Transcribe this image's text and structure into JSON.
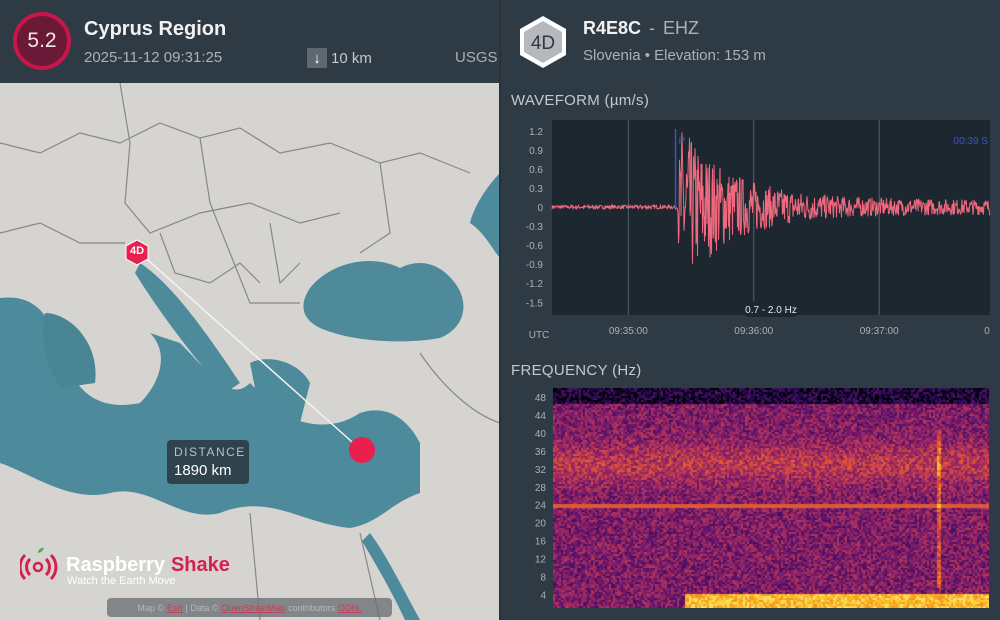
{
  "event": {
    "magnitude": "5.2",
    "region": "Cyprus Region",
    "datetime": "2025-11-12 09:31:25",
    "depth": "10 km",
    "depth_icon": "arrow-down-icon",
    "source": "USGS"
  },
  "map": {
    "distance_label": "DISTANCE",
    "distance_value": "1890 km",
    "station_marker": "4D",
    "brand_part1": "Raspberry",
    "brand_part2": "Shake",
    "brand_tagline": "Watch the Earth Move",
    "attribution": {
      "map_prefix": "Map ©",
      "map_link": "Esri",
      "data_prefix": "| Data ©",
      "data_link": "OpenStreetMap",
      "contributors": "contributors",
      "license_link": "ODbL"
    }
  },
  "station": {
    "network": "4D",
    "code": "R4E8C",
    "dash": "-",
    "channel": "EHZ",
    "location": "Slovenia • Elevation: 153 m"
  },
  "waveform": {
    "title": "WAVEFORM  (µm/s)",
    "filter_label": "0.7 - 2.0 Hz",
    "p_label": "P",
    "s_label": "00:39  S",
    "tz_label": "UTC"
  },
  "frequency": {
    "title": "FREQUENCY  (Hz)"
  },
  "colors": {
    "accent": "#d4204f",
    "wave": "#f0687e",
    "pick": "#3b55c8"
  },
  "chart_data": [
    {
      "type": "line",
      "title": "WAVEFORM (µm/s)",
      "ylabel": "µm/s",
      "xlabel": "UTC",
      "ylim": [
        -1.7,
        1.37
      ],
      "yticks": [
        "1.2",
        "0.9",
        "0.6",
        "0.3",
        "0",
        "-0.3",
        "-0.6",
        "-0.9",
        "-1.2",
        "-1.5"
      ],
      "xticks": [
        "09:35:00",
        "09:36:00",
        "09:37:00",
        "0"
      ],
      "x_range_seconds": [
        -36.5,
        173
      ],
      "p_arrival_seconds": 22.6,
      "peak_amplitude": 1.37,
      "min_amplitude": -1.7,
      "noise_amplitude": 0.03,
      "coda_amplitude": 0.12
    },
    {
      "type": "heatmap",
      "title": "FREQUENCY (Hz)",
      "ylabel": "Hz",
      "yticks": [
        "48",
        "44",
        "40",
        "36",
        "32",
        "28",
        "24",
        "20",
        "16",
        "12",
        "8",
        "4"
      ],
      "ylim": [
        1,
        50
      ],
      "persistent_line_hz": 24,
      "colormap": "magma"
    }
  ]
}
